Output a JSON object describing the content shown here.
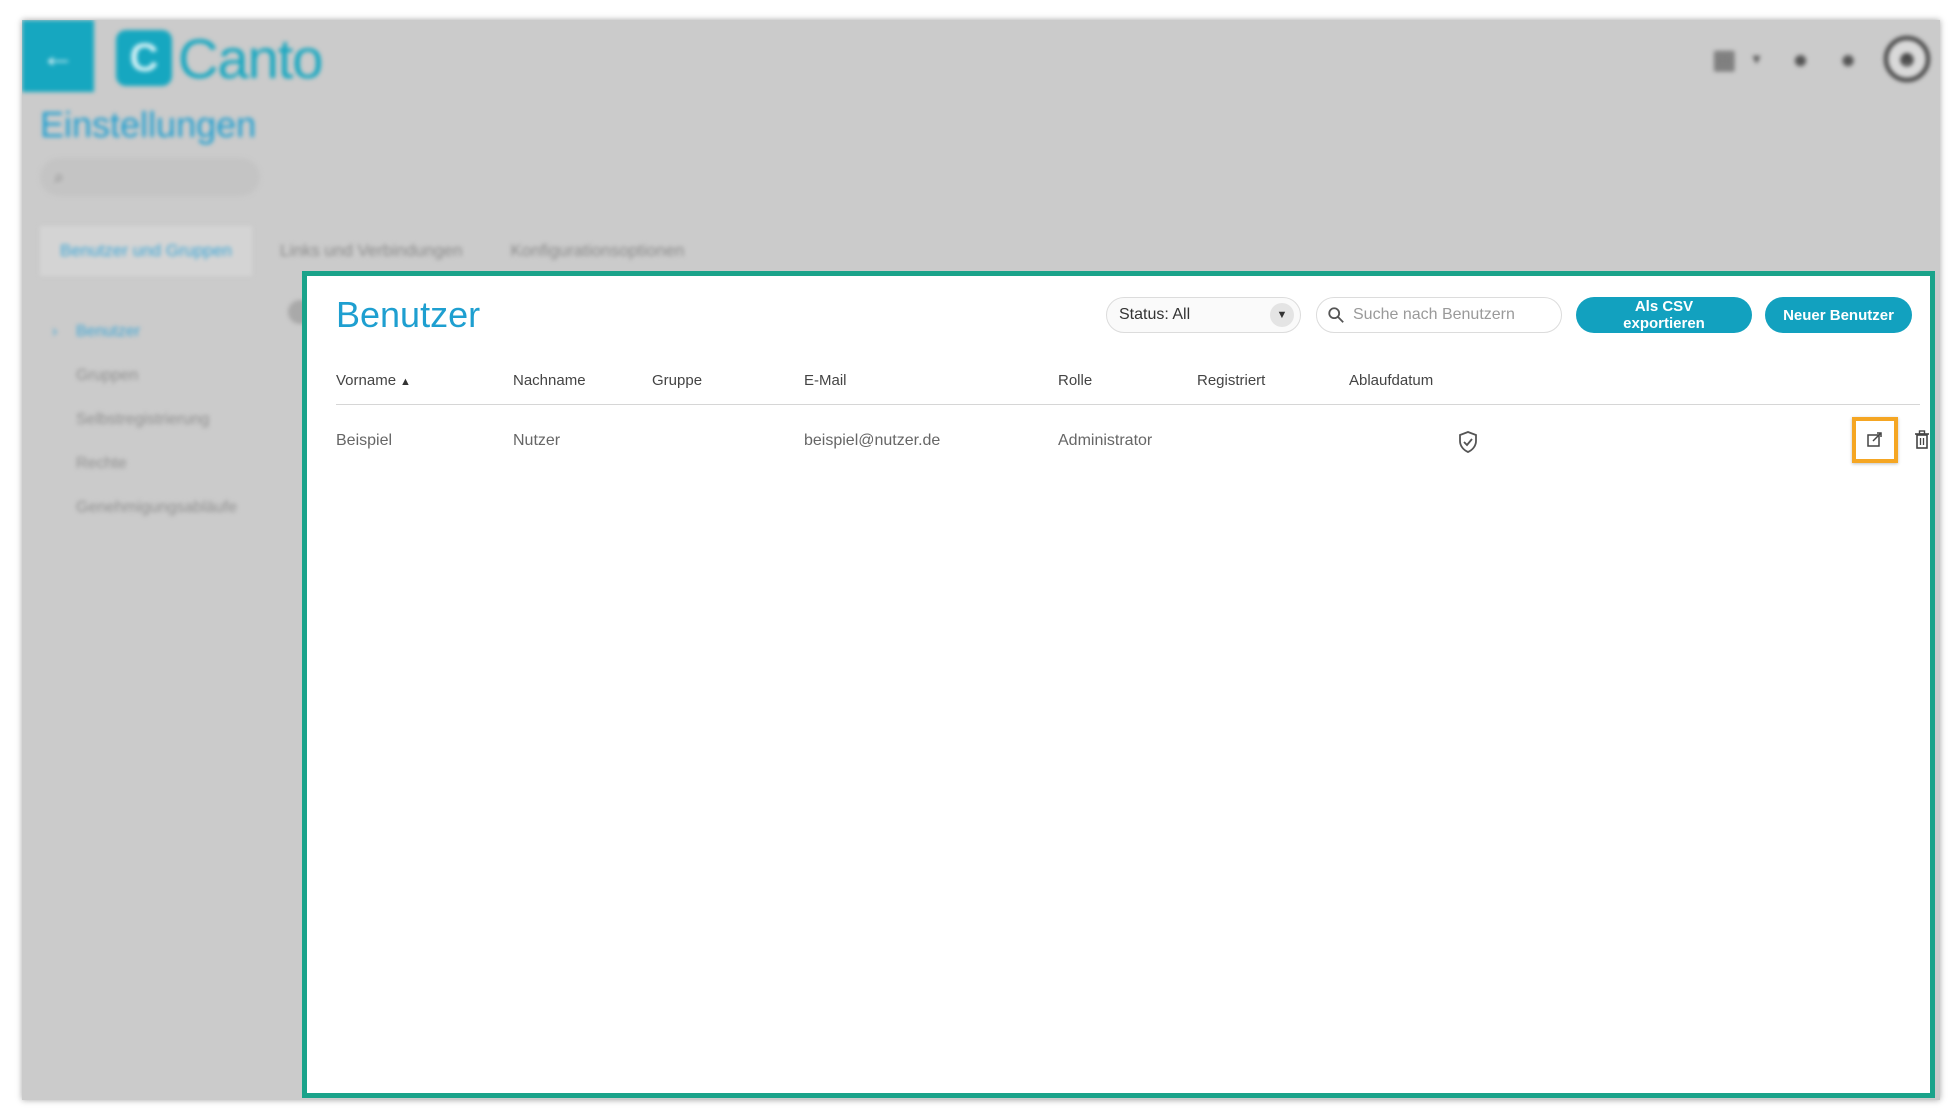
{
  "app": {
    "back_symbol": "←",
    "logo_mark": "C",
    "logo_text": "Canto",
    "page_heading": "Einstellungen",
    "settings_search_icon": "⌕",
    "tabs": [
      {
        "label": "Benutzer und Gruppen"
      },
      {
        "label": "Links und Verbindungen"
      },
      {
        "label": "Konfigurationsoptionen"
      }
    ],
    "sidebar": [
      {
        "label": "Benutzer"
      },
      {
        "label": "Gruppen"
      },
      {
        "label": "Selbstregistrierung"
      },
      {
        "label": "Rechte"
      },
      {
        "label": "Genehmigungsabläufe"
      }
    ],
    "top_icons": {
      "apps": "▦",
      "apps_caret": "▾",
      "help": "●",
      "notifications": "●",
      "avatar": "☻"
    }
  },
  "panel": {
    "title": "Benutzer",
    "status_filter": {
      "value": "Status: All",
      "caret": "▼"
    },
    "search": {
      "placeholder": "Suche nach Benutzern"
    },
    "export_label": "Als CSV exportieren",
    "new_user_label": "Neuer Benutzer",
    "columns": [
      "Vorname",
      "Nachname",
      "Gruppe",
      "E-Mail",
      "Rolle",
      "Registriert",
      "Ablaufdatum"
    ],
    "sort_indicator": "▲",
    "rows": [
      {
        "vorname": "Beispiel",
        "nachname": "Nutzer",
        "gruppe": "",
        "email": "beispiel@nutzer.de",
        "rolle": "Administrator",
        "registriert_icon": "shield-check-icon",
        "ablaufdatum": ""
      }
    ]
  },
  "colors": {
    "accent": "#12a1bf",
    "highlight_panel": "#1aa38a",
    "highlight_edit": "#f5a623",
    "title_blue": "#1e9fd0"
  }
}
